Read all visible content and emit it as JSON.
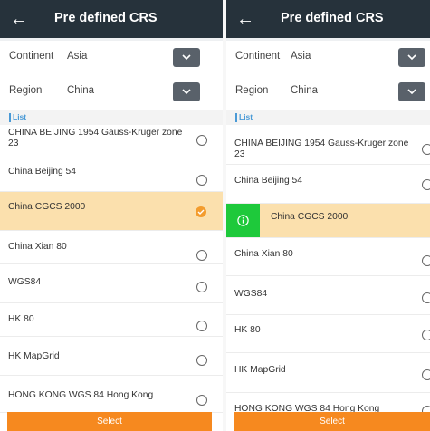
{
  "header": {
    "title": "Pre defined CRS"
  },
  "continent": {
    "label": "Continent",
    "value": "Asia"
  },
  "region": {
    "label": "Region",
    "value": "China"
  },
  "list": {
    "title": "List",
    "items": [
      "CHINA BEIJING 1954 Gauss-Kruger zone 23",
      "China Beijing 54",
      "China CGCS 2000",
      "China Xian 80",
      "WGS84",
      "HK 80",
      "HK MapGrid",
      "HONG KONG WGS 84 Hong Kong"
    ],
    "selected_index": 2
  },
  "select_button": {
    "label": "Select"
  },
  "colors": {
    "header_bg": "#26323b",
    "accent_orange": "#f6891f",
    "selected_row_bg": "#fbe0ad",
    "list_title_blue": "#4a9ad6",
    "toast_green": "#1ec93b"
  },
  "icons": [
    "back-arrow-icon",
    "chevron-down-icon",
    "radio-icon",
    "check-icon",
    "info-icon"
  ]
}
